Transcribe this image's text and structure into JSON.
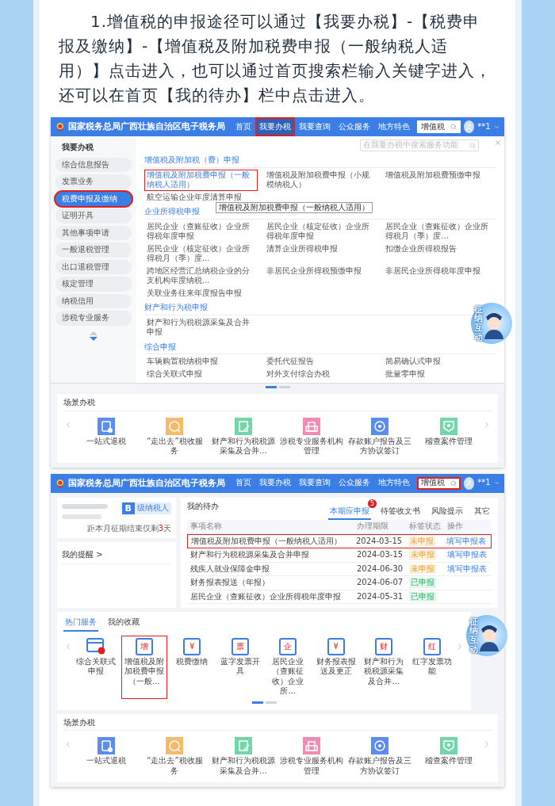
{
  "intro": "1.增值税的申报途径可以通过【我要办税】-【税费申报及缴纳】-【增值税及附加税费申报（一般纳税人适用）】点击进入，也可以通过首页搜索栏输入关键字进入，还可以在首页【我的待办】栏中点击进入。",
  "shot1": {
    "header": {
      "title": "国家税务总局广西壮族自治区电子税务局",
      "nav": [
        {
          "label": "首页",
          "selected": false,
          "highlighted": false
        },
        {
          "label": "我要办税",
          "selected": true,
          "highlighted": true
        },
        {
          "label": "我要查询",
          "selected": false,
          "highlighted": false
        },
        {
          "label": "公众服务",
          "selected": false,
          "highlighted": false
        },
        {
          "label": "地方特色",
          "selected": false,
          "highlighted": false
        }
      ],
      "search": {
        "value": "增值税",
        "highlighted": false
      },
      "user": "**1"
    },
    "sidebar": {
      "title": "我要办税",
      "items": [
        {
          "label": "综合信息报告",
          "selected": false,
          "highlighted": false
        },
        {
          "label": "发票业务",
          "selected": false,
          "highlighted": false
        },
        {
          "label": "税费申报及缴纳",
          "selected": true,
          "highlighted": true
        },
        {
          "label": "证明开具",
          "selected": false,
          "highlighted": false
        },
        {
          "label": "其他事项申请",
          "selected": false,
          "highlighted": false
        },
        {
          "label": "一般退税管理",
          "selected": false,
          "highlighted": false
        },
        {
          "label": "出口退税管理",
          "selected": false,
          "highlighted": false
        },
        {
          "label": "核定管理",
          "selected": false,
          "highlighted": false
        },
        {
          "label": "纳税信用",
          "selected": false,
          "highlighted": false
        },
        {
          "label": "涉税专业服务",
          "selected": false,
          "highlighted": false
        }
      ]
    },
    "panel": {
      "search_placeholder": "在我要办税中搜索服务功能",
      "sections": [
        {
          "title": "增值税及附加税（费）申报",
          "items": [
            {
              "label": "增值税及附加税费申报（一般纳税人适用）",
              "highlighted": true,
              "tooltip": "增值税及附加税费申报（一般纳税人适用）"
            },
            {
              "label": "增值税及附加税费申报（小规模纳税人）",
              "highlighted": false
            },
            {
              "label": "增值税及附加税费预缴申报",
              "highlighted": false
            },
            {
              "label": "航空运输企业年度清算申报",
              "highlighted": false
            }
          ]
        },
        {
          "title": "企业所得税申报",
          "items": [
            {
              "label": "居民企业（查账征收）企业所得税年度申报",
              "highlighted": false
            },
            {
              "label": "居民企业（核定征收）企业所得税年度申报",
              "highlighted": false
            },
            {
              "label": "居民企业（查账征收）企业所得税月（季）度...",
              "highlighted": false
            },
            {
              "label": "居民企业（核定征收）企业所得税月（季）度...",
              "highlighted": false
            },
            {
              "label": "清算企业所得税申报",
              "highlighted": false
            },
            {
              "label": "扣缴企业所得税报告",
              "highlighted": false
            },
            {
              "label": "跨地区经营汇总纳税企业的分支机构年度纳税...",
              "highlighted": false
            },
            {
              "label": "非居民企业所得税预缴申报",
              "highlighted": false
            },
            {
              "label": "非居民企业所得税年度申报",
              "highlighted": false
            },
            {
              "label": "关联业务往来年度报告申报",
              "highlighted": false
            }
          ]
        },
        {
          "title": "财产和行为税申报",
          "items": [
            {
              "label": "财产和行为税税源采集及合并申报",
              "highlighted": false
            }
          ]
        },
        {
          "title": "综合申报",
          "items": [
            {
              "label": "车辆购置税纳税申报",
              "highlighted": false
            },
            {
              "label": "委托代征报告",
              "highlighted": false
            },
            {
              "label": "简易确认式申报",
              "highlighted": false
            },
            {
              "label": "综合关联式申报",
              "highlighted": false
            },
            {
              "label": "对外支付综合办税",
              "highlighted": false
            },
            {
              "label": "批量零申报",
              "highlighted": false
            }
          ]
        }
      ]
    },
    "pager": [
      {
        "selected": true
      },
      {
        "selected": false
      }
    ],
    "mascot": {
      "label": "征纳互动"
    },
    "scene": {
      "title": "场景办税",
      "items": [
        {
          "label": "一站式退税",
          "color": "#5b8def"
        },
        {
          "label": "“走出去”税收服务",
          "color": "#f7b96a"
        },
        {
          "label": "财产和行为税税源采集及合并...",
          "color": "#72d6a8"
        },
        {
          "label": "涉税专业服务机构管理",
          "color": "#f08bb4"
        },
        {
          "label": "存款账户报告及三方协议签订",
          "color": "#5b8def"
        },
        {
          "label": "稽查案件管理",
          "color": "#72d6a8"
        }
      ]
    }
  },
  "shot2": {
    "header": {
      "title": "国家税务总局广西壮族自治区电子税务局",
      "nav": [
        {
          "label": "首页",
          "selected": false,
          "highlighted": false
        },
        {
          "label": "我要办税",
          "selected": false,
          "highlighted": false
        },
        {
          "label": "我要查询",
          "selected": false,
          "highlighted": false
        },
        {
          "label": "公众服务",
          "selected": false,
          "highlighted": false
        },
        {
          "label": "地方特色",
          "selected": false,
          "highlighted": false
        }
      ],
      "search": {
        "value": "增值税",
        "highlighted": true
      },
      "user": "**1"
    },
    "profile": {
      "grade": "B",
      "grade_label": "级纳税人",
      "deadline": "距本月征期结束仅剩**3**天"
    },
    "reminders": {
      "title": "我的提醒 >"
    },
    "todo": {
      "title": "我的待办",
      "tabs": [
        {
          "label": "本期应申报",
          "selected": true,
          "badge": "5"
        },
        {
          "label": "待签收文书",
          "selected": false
        },
        {
          "label": "风险提示",
          "selected": false
        },
        {
          "label": "其它",
          "selected": false
        }
      ],
      "columns": [
        "事项名称",
        "办理期限",
        "标签状态",
        "操作"
      ],
      "rows": [
        {
          "name": "增值税及附加税费申报（一般纳税人适用）",
          "date": "2024-03-15",
          "status": "未申报",
          "kind": "pending",
          "action": "填写申报表",
          "highlighted": true
        },
        {
          "name": "财产和行为税税源采集及合并申报",
          "date": "2024-03-15",
          "status": "未申报",
          "kind": "pending",
          "action": "填写申报表",
          "highlighted": false
        },
        {
          "name": "残疾人就业保障金申报",
          "date": "2024-06-30",
          "status": "未申报",
          "kind": "pending",
          "action": "填写申报表",
          "highlighted": false
        },
        {
          "name": "财务报表报送（年报）",
          "date": "2024-06-07",
          "status": "已申报",
          "kind": "done",
          "highlighted": false
        },
        {
          "name": "居民企业（查账征收）企业所得税年度申报",
          "date": "2024-05-31",
          "status": "已申报",
          "kind": "done",
          "highlighted": false
        }
      ]
    },
    "hot": {
      "tabs": [
        {
          "label": "热门服务",
          "selected": true
        },
        {
          "label": "我的收藏",
          "selected": false
        }
      ],
      "items": [
        {
          "label": "综合关联式申报",
          "highlighted": false
        },
        {
          "label": "增值税及附加税费申报（一般...",
          "glyph": "增",
          "highlighted": true
        },
        {
          "label": "税费缴纳",
          "glyph": "¥",
          "highlighted": false
        },
        {
          "label": "蓝字发票开具",
          "glyph": "票",
          "highlighted": false
        },
        {
          "label": "居民企业（查账征收）企业所...",
          "glyph": "企",
          "highlighted": false
        },
        {
          "label": "财务报表报送及更正",
          "glyph": "¥",
          "highlighted": false
        },
        {
          "label": "财产和行为税税源采集及合并...",
          "glyph": "财",
          "highlighted": false
        },
        {
          "label": "红字发票功能",
          "glyph": "红",
          "highlighted": false
        }
      ],
      "pager": [
        {
          "selected": true
        },
        {
          "selected": false
        }
      ]
    },
    "mascot": {
      "label": "征纳互动"
    },
    "scene": {
      "title": "场景办税",
      "items": [
        {
          "label": "一站式退税",
          "color": "#5b8def"
        },
        {
          "label": "“走出去”税收服务",
          "color": "#f7b96a"
        },
        {
          "label": "财产和行为税税源采集及合并...",
          "color": "#72d6a8"
        },
        {
          "label": "涉税专业服务机构管理",
          "color": "#f08bb4"
        },
        {
          "label": "存款账户报告及三方协议签订",
          "color": "#5b8def"
        },
        {
          "label": "稽查案件管理",
          "color": "#72d6a8"
        }
      ]
    }
  }
}
